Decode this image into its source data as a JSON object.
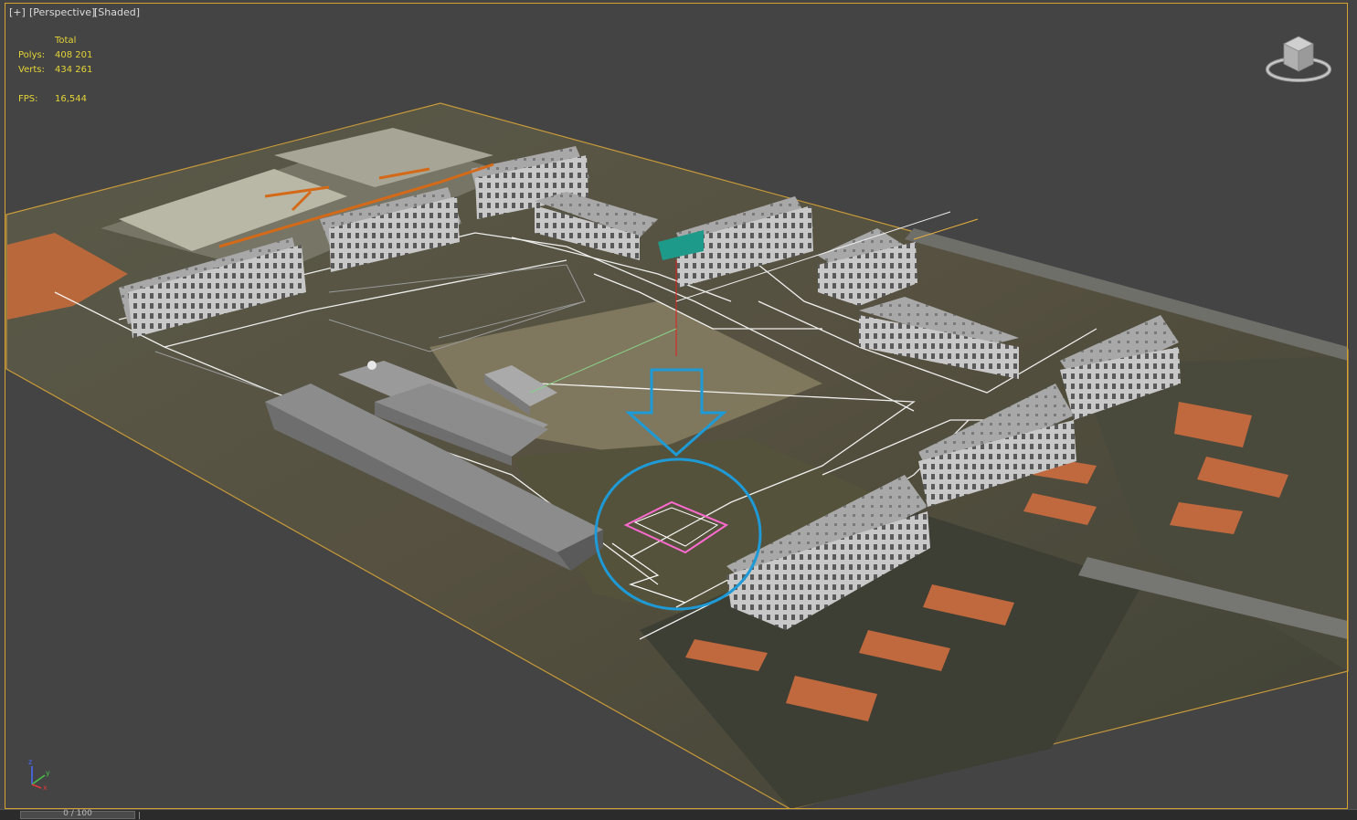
{
  "viewport": {
    "label_plus": "[+]",
    "label_view": "[Perspective]",
    "label_shading": "[Shaded]"
  },
  "stats": {
    "header": "Total",
    "polys_label": "Polys:",
    "polys_value": "408 201",
    "verts_label": "Verts:",
    "verts_value": "434 261",
    "fps_label": "FPS:",
    "fps_value": "16,544"
  },
  "axis": {
    "z": "z",
    "y": "y",
    "x": "x"
  },
  "timeline": {
    "slider_label": "0 / 100"
  },
  "viewcube": {
    "icon": "viewcube-icon"
  },
  "colors": {
    "viewport_bg": "#444444",
    "selection_border": "#d6a330",
    "stats_text": "#e4d436",
    "annotation": "#1e9ad6",
    "selected_object": "#ff6ad0"
  }
}
